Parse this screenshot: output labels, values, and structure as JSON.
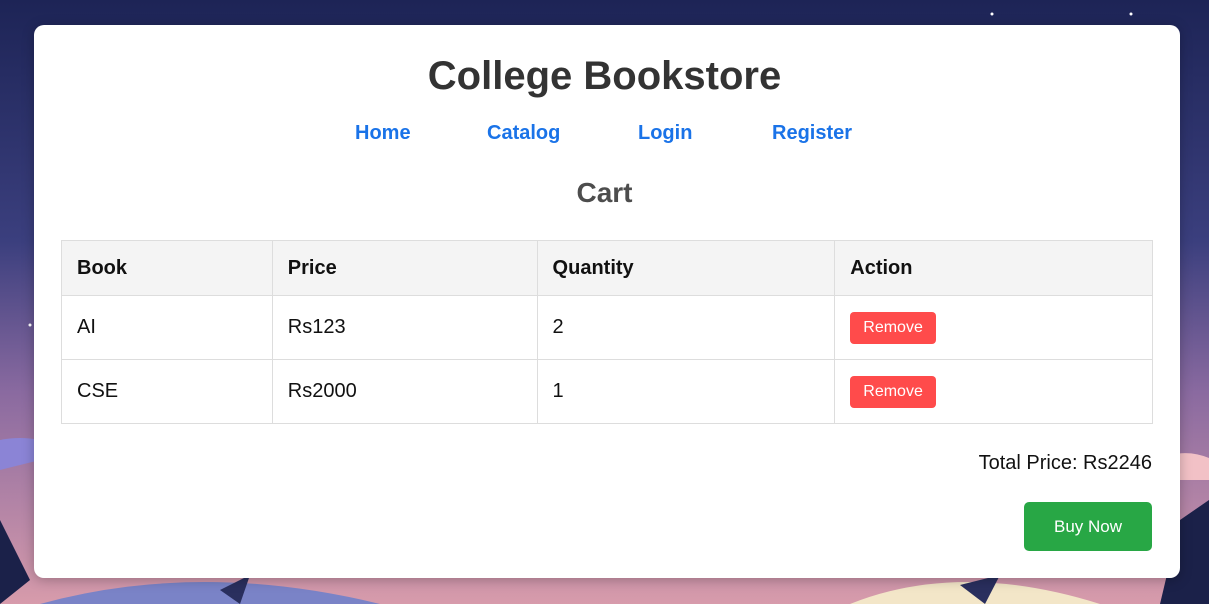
{
  "header": {
    "title": "College Bookstore"
  },
  "nav": {
    "items": [
      {
        "label": "Home"
      },
      {
        "label": "Catalog"
      },
      {
        "label": "Login"
      },
      {
        "label": "Register"
      }
    ]
  },
  "cart": {
    "heading": "Cart",
    "columns": [
      "Book",
      "Price",
      "Quantity",
      "Action"
    ],
    "rows": [
      {
        "book": "AI",
        "price": "Rs123",
        "quantity": "2",
        "action": "Remove"
      },
      {
        "book": "CSE",
        "price": "Rs2000",
        "quantity": "1",
        "action": "Remove"
      }
    ],
    "total_text": "Total Price: Rs2246",
    "buy_label": "Buy Now"
  },
  "colors": {
    "link": "#1a73e8",
    "remove": "#ff4b4b",
    "buy": "#28a745"
  }
}
